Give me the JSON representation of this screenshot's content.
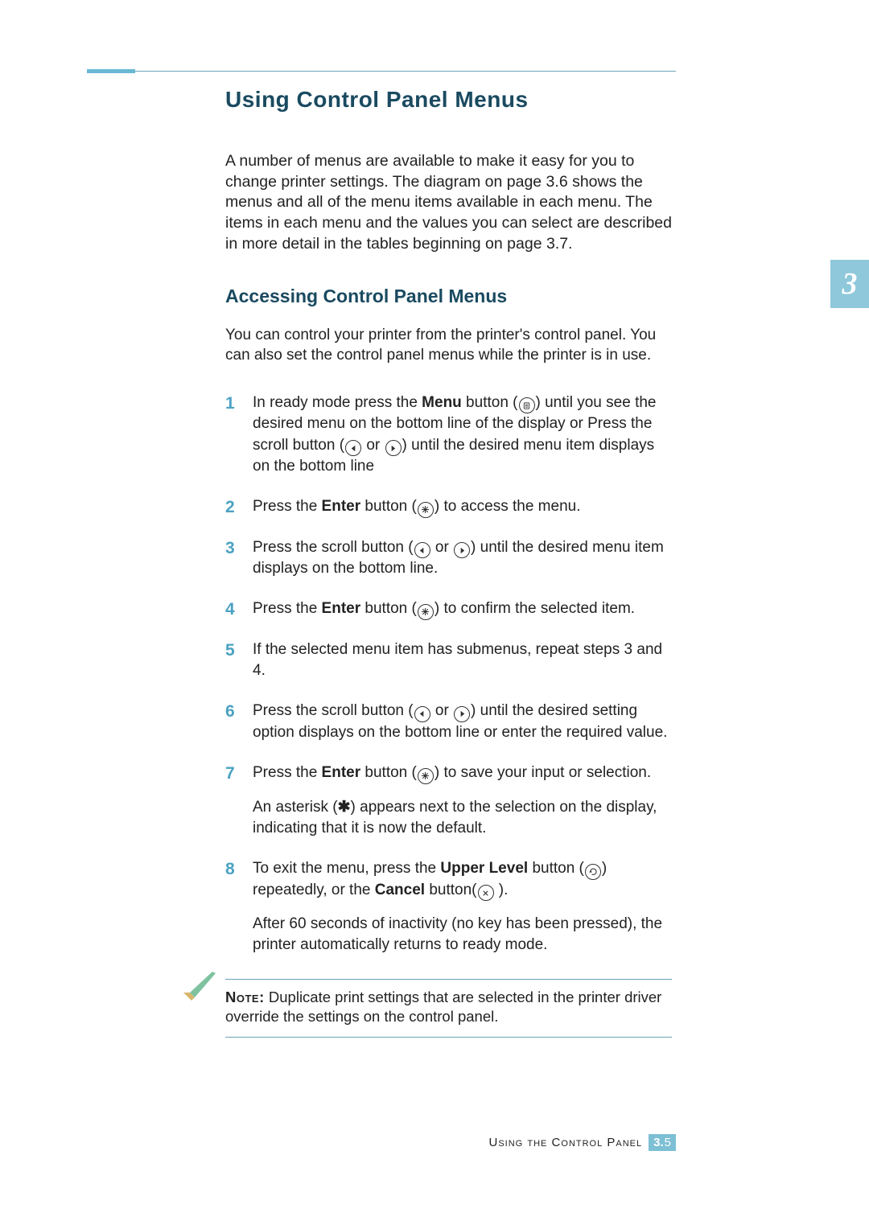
{
  "chapter_tab": "3",
  "title": "Using Control Panel Menus",
  "intro": "A number of menus are available to make it easy for you to change printer settings. The diagram on page 3.6 shows the menus and all of the menu items available in each menu. The items in each menu and the values you can select are described in more detail in the tables beginning on page 3.7.",
  "sub_title": "Accessing Control Panel Menus",
  "sub_intro": "You can control your printer from the printer's control panel. You can also set the control panel menus while the printer is in use.",
  "steps": {
    "s1": {
      "num": "1",
      "a": "In ready mode press the ",
      "b_menu": "Menu",
      "b": " button (",
      "c": ") until you see the desired menu on the bottom line of the display or Press the scroll button (",
      "d": " or ",
      "e": ") until the desired menu item displays on the bottom line"
    },
    "s2": {
      "num": "2",
      "a": "Press the ",
      "b_enter": "Enter",
      "b": " button (",
      "c": ") to access the menu."
    },
    "s3": {
      "num": "3",
      "a": "Press the scroll button (",
      "b": " or ",
      "c": ") until the desired menu item displays on the bottom line."
    },
    "s4": {
      "num": "4",
      "a": "Press the ",
      "b_enter": "Enter",
      "b": " button (",
      "c": ") to confirm the selected item."
    },
    "s5": {
      "num": "5",
      "a": "If the selected menu item has submenus, repeat steps 3 and 4."
    },
    "s6": {
      "num": "6",
      "a": "Press the scroll button (",
      "b": " or ",
      "c": ") until the desired setting option displays on the bottom line or enter the required value."
    },
    "s7": {
      "num": "7",
      "a": "Press the ",
      "b_enter": "Enter",
      "b": " button (",
      "c": ") to save your input or selection.",
      "extra_a": "An asterisk (",
      "extra_b": ") appears next to the selection on the display, indicating that it is now the default."
    },
    "s8": {
      "num": "8",
      "a": "To exit the menu, press the ",
      "b_upper": "Upper Level",
      "b": " button (",
      "c": ") repeatedly, or the ",
      "b_cancel": "Cancel",
      "d": " button(",
      "e": " ).",
      "extra": "After 60 seconds of inactivity (no key has been pressed), the printer automatically returns to ready mode."
    }
  },
  "note": {
    "label": "Note:",
    "text": " Duplicate print settings that are selected in the printer driver override the settings on the control panel."
  },
  "footer": {
    "text": "Using the Control Panel",
    "chapter": "3.",
    "page": "5"
  }
}
